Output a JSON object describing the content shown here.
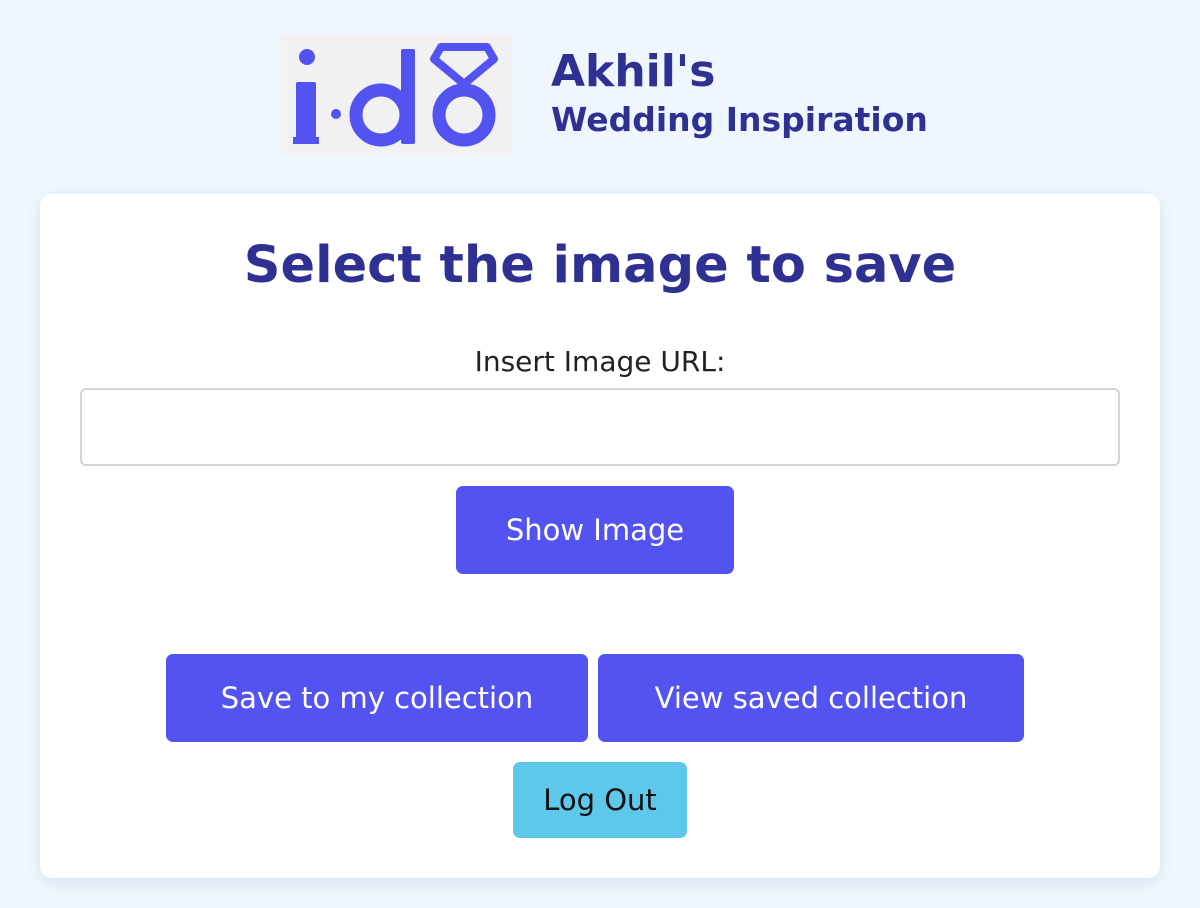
{
  "header": {
    "logo_text": "i·dŏ",
    "logo_color": "#5353f1",
    "brand_name": "Akhil's",
    "brand_subtitle": "Wedding Inspiration"
  },
  "main": {
    "title": "Select the image to save",
    "url_label": "Insert Image URL:",
    "url_value": "",
    "url_placeholder": "",
    "show_button_label": "Show Image",
    "save_button_label": "Save to my collection",
    "view_button_label": "View saved collection",
    "logout_button_label": "Log Out"
  },
  "colors": {
    "page_background": "#eff6fe",
    "heading": "#2f3192",
    "primary_button": "#5353f1",
    "logout_button": "#5ec8eb"
  }
}
